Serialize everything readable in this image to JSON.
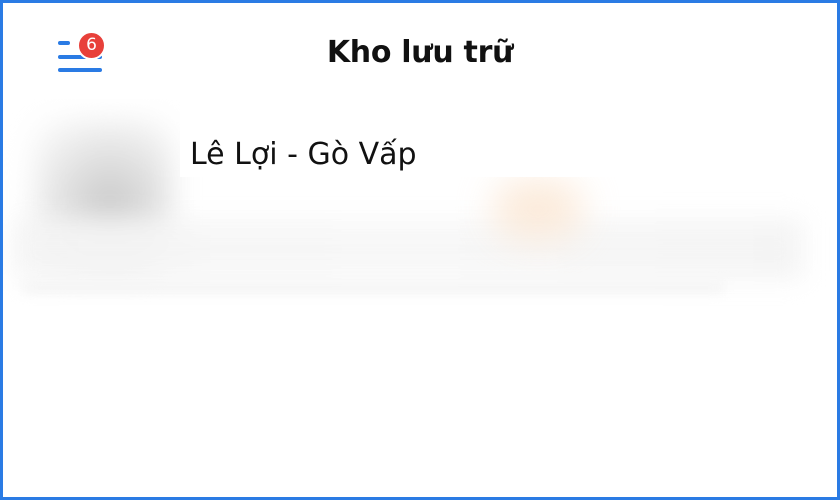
{
  "header": {
    "title": "Kho lưu trữ",
    "menu_badge_count": "6"
  },
  "colors": {
    "accent": "#2a7be4",
    "badge": "#e8403a"
  },
  "icons": {
    "menu": "menu-lines-icon"
  },
  "store": {
    "name": "Lê Lợi - Gò Vấp"
  }
}
